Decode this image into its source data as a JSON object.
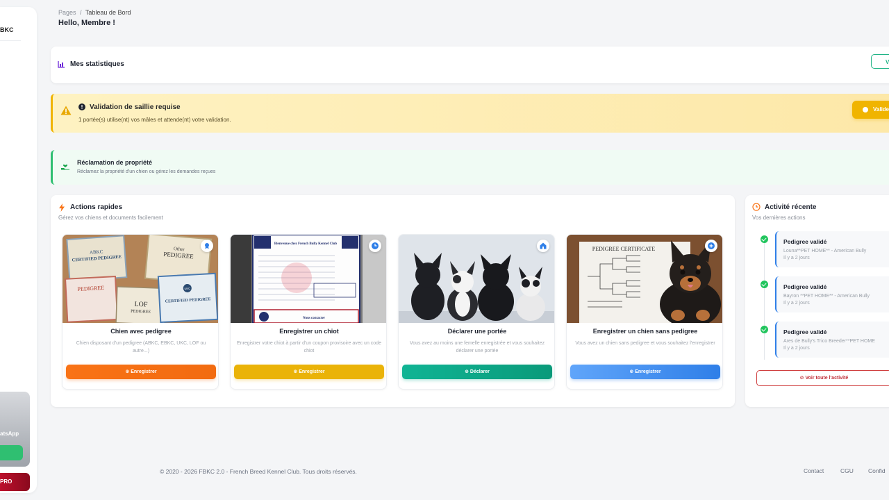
{
  "sidebar": {
    "brand": "BKC",
    "whatsapp_label": "atsApp",
    "pro_label": "PRO"
  },
  "header": {
    "breadcrumb_root": "Pages",
    "breadcrumb_sep": "/",
    "breadcrumb_current": "Tableau de Bord",
    "greeting": "Hello, Membre !"
  },
  "stats": {
    "title": "Mes statistiques",
    "button_label": "V"
  },
  "warning": {
    "title": "Validation de saillie requise",
    "message": "1 portée(s) utilise(nt) vos mâles et attende(nt) votre validation.",
    "button_label": "Valide"
  },
  "claim": {
    "title": "Réclamation de propriété",
    "message": "Réclamez la propriété d'un chien ou gérez les demandes reçues"
  },
  "actions": {
    "title": "Actions rapides",
    "subtitle": "Gérez vos chiens et documents facilement",
    "cards": [
      {
        "title": "Chien avec pedigree",
        "description": "Chien disposant d'un pedigree (ABKC, EBKC, UKC, LOF ou autre...)",
        "button": "⊕ Enregistrer"
      },
      {
        "title": "Enregistrer un chiot",
        "description": "Enregistrer votre chiot à partir d'un coupon provisoire avec un code chiot",
        "button": "⊕ Enregistrer"
      },
      {
        "title": "Déclarer une portée",
        "description": "Vous avez au moins une femelle enregistrée et vous souhaitez déclarer une portée",
        "button": "⊕ Déclarer"
      },
      {
        "title": "Enregistrer un chien sans pedigree",
        "description": "Vous avez un chien sans pedigree et vous souhaitez l'enregistrer",
        "button": "⊕ Enregistrer"
      }
    ],
    "image_text": {
      "ped1_top": "ABKC",
      "ped1_main": "CERTIFIED PEDIGREE",
      "ped2_top": "Other",
      "ped2_main": "PEDIGREE",
      "ped3_main": "PEDIGREE",
      "ped4_top": "UKC",
      "ped4_main": "CERTIFIED PEDIGREE",
      "ped5_main": "LOF",
      "ped5_sub": "PEDIGREE",
      "coupon_title": "Bienvenue chez French Bully Kennel Club",
      "coupon_footer": "Nous contacter",
      "cert_title": "PEDIGREE CERTIFICATE"
    }
  },
  "activity": {
    "title": "Activité récente",
    "subtitle": "Vos dernières actions",
    "items": [
      {
        "title": "Pedigree validé",
        "description": "Louna**PET HOME** - American Bully",
        "time": "Il y a 2 jours"
      },
      {
        "title": "Pedigree validé",
        "description": "Bayron **PET HOME** - American Bully",
        "time": "Il y a 2 jours"
      },
      {
        "title": "Pedigree validé",
        "description": "Ares de Bully's Trico Breeder**PET HOME",
        "time": "Il y a 2 jours"
      }
    ],
    "view_all": "⊘ Voir toute l'activité"
  },
  "footer": {
    "copyright": "© 2020 - 2026 FBKC 2.0 - French Breed Kennel Club. Tous droits réservés.",
    "links": [
      "Contact",
      "CGU",
      "Confid"
    ]
  },
  "colors": {
    "accent_green": "#20b486",
    "warning_yellow": "#f0b400",
    "orange": "#f97316",
    "teal": "#10b494",
    "blue": "#2f7fe8",
    "danger": "#c0303a"
  }
}
